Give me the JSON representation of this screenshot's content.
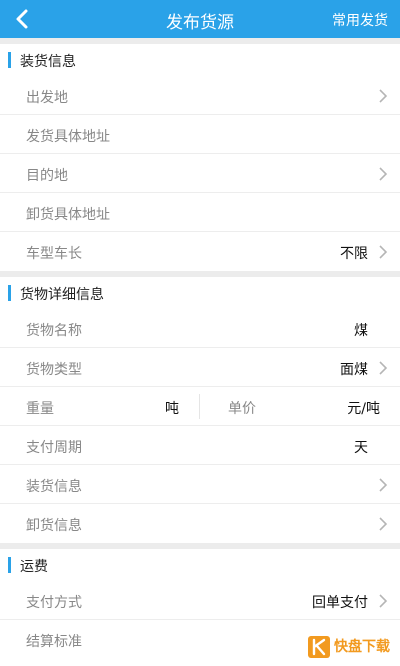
{
  "header": {
    "title": "发布货源",
    "action_label": "常用发货"
  },
  "loading_section": {
    "title": "装货信息",
    "rows": [
      {
        "label": "出发地",
        "value": "",
        "arrow": true
      },
      {
        "label": "发货具体地址",
        "value": "",
        "arrow": false
      },
      {
        "label": "目的地",
        "value": "",
        "arrow": true
      },
      {
        "label": "卸货具体地址",
        "value": "",
        "arrow": false
      },
      {
        "label": "车型车长",
        "value": "不限",
        "arrow": true
      }
    ]
  },
  "cargo_section": {
    "title": "货物详细信息",
    "name": {
      "label": "货物名称",
      "value": "煤"
    },
    "type": {
      "label": "货物类型",
      "value": "面煤"
    },
    "weight": {
      "label": "重量",
      "unit": "吨"
    },
    "unit_price": {
      "label": "单价",
      "unit": "元/吨"
    },
    "pay_cycle": {
      "label": "支付周期",
      "unit": "天"
    },
    "load_info": {
      "label": "装货信息"
    },
    "unload_info": {
      "label": "卸货信息"
    }
  },
  "freight_section": {
    "title": "运费",
    "pay_method": {
      "label": "支付方式",
      "value": "回单支付"
    },
    "settlement": {
      "label": "结算标准",
      "value": ""
    }
  },
  "watermark": {
    "text": "快盘下载"
  },
  "colors": {
    "accent": "#2aa2e8",
    "watermark": "#f29a1f"
  }
}
